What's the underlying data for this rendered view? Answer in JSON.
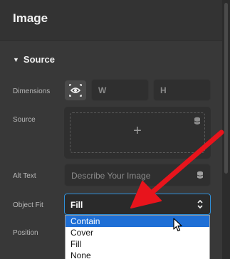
{
  "header": {
    "title": "Image"
  },
  "section": {
    "title": "Source",
    "toggle_icon": "caret-down-icon"
  },
  "labels": {
    "dimensions": "Dimensions",
    "source": "Source",
    "alt_text": "Alt Text",
    "object_fit": "Object Fit",
    "position": "Position"
  },
  "dimensions": {
    "lock_icon": "aspect-ratio-eye-icon",
    "width_placeholder": "W",
    "height_placeholder": "H"
  },
  "source": {
    "add_symbol": "+",
    "dynamic_icon": "database-icon"
  },
  "alt_text": {
    "placeholder": "Describe Your Image",
    "dynamic_icon": "database-icon"
  },
  "object_fit": {
    "value": "Fill",
    "chevron_icon": "up-down-chevron-icon",
    "options": [
      "Contain",
      "Cover",
      "Fill",
      "None"
    ],
    "highlighted": "Contain"
  },
  "colors": {
    "panel_bg": "#383838",
    "focus_border": "#2f8fd8",
    "highlight": "#1e6fd6",
    "annotation_arrow": "#e8141c"
  }
}
